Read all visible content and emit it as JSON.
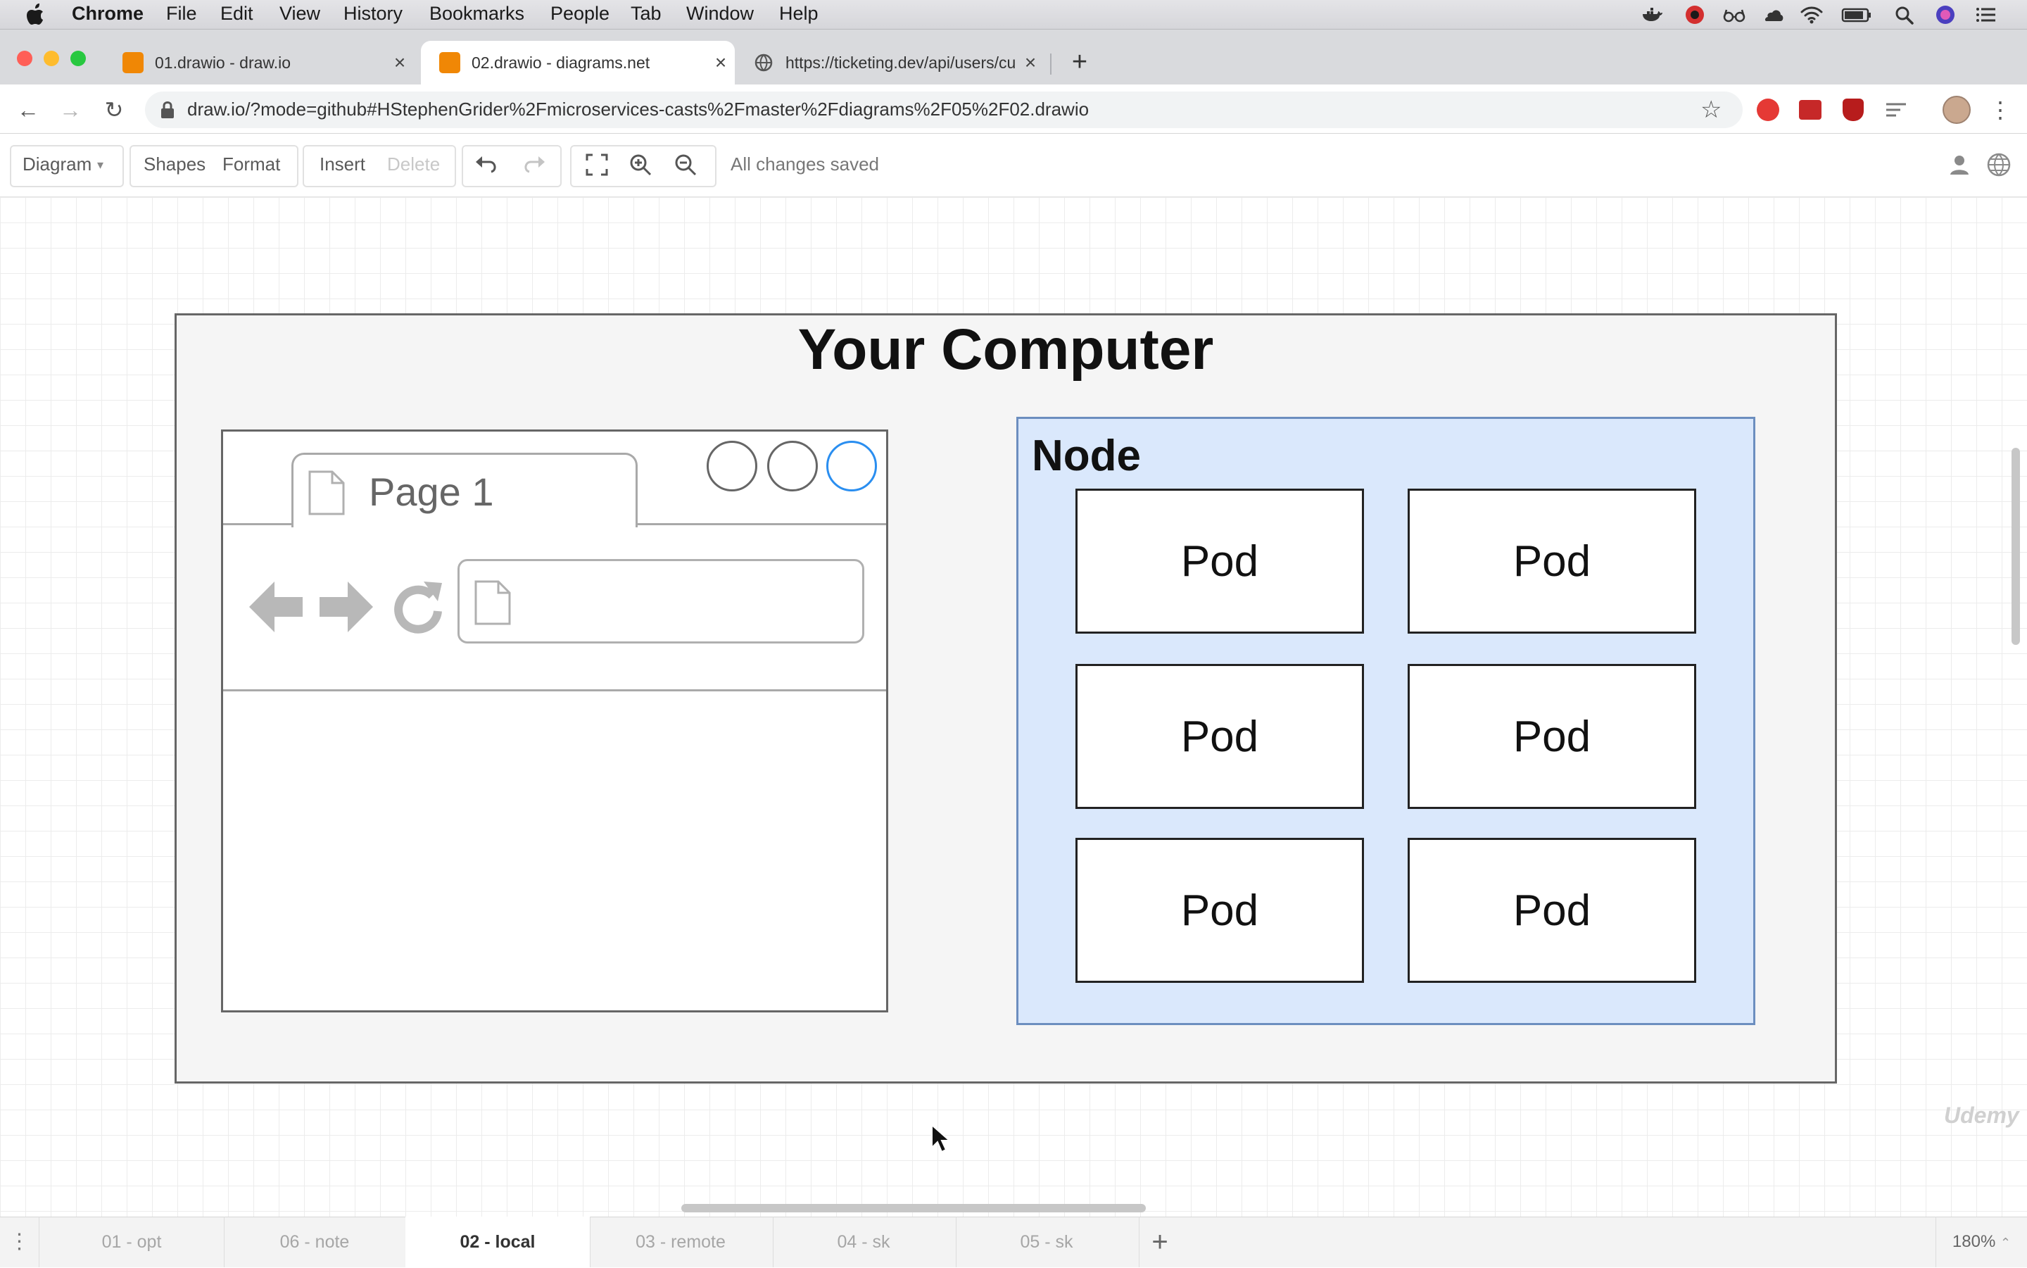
{
  "menubar": {
    "app": "Chrome",
    "items": [
      "File",
      "Edit",
      "View",
      "History",
      "Bookmarks",
      "People",
      "Tab",
      "Window",
      "Help"
    ]
  },
  "tabs": [
    {
      "title": "01.drawio - draw.io",
      "favicon": "drawio-icon",
      "active": false
    },
    {
      "title": "02.drawio - diagrams.net",
      "favicon": "drawio-icon",
      "active": true
    },
    {
      "title": "https://ticketing.dev/api/users/cu",
      "favicon": "globe-icon",
      "active": false
    }
  ],
  "address_bar": {
    "url": "draw.io/?mode=github#HStephenGrider%2Fmicroservices-casts%2Fmaster%2Fdiagrams%2F05%2F02.drawio"
  },
  "toolbar": {
    "diagram": "Diagram",
    "shapes": "Shapes",
    "format": "Format",
    "insert": "Insert",
    "delete": "Delete",
    "status": "All changes saved"
  },
  "diagram": {
    "title": "Your Computer",
    "browser_tab": "Page 1",
    "node_label": "Node",
    "pods": [
      "Pod",
      "Pod",
      "Pod",
      "Pod",
      "Pod",
      "Pod"
    ]
  },
  "watermark": "Udemy",
  "page_tabs": [
    {
      "label": "01 - opt",
      "active": false
    },
    {
      "label": "06 - note",
      "active": false
    },
    {
      "label": "02 - local",
      "active": true
    },
    {
      "label": "03 - remote",
      "active": false
    },
    {
      "label": "04 - sk",
      "active": false
    },
    {
      "label": "05 - sk",
      "active": false
    }
  ],
  "zoom": "180%",
  "colors": {
    "node_fill": "#dae8fc",
    "node_border": "#6c8ebf",
    "container_fill": "#f5f5f5",
    "accent_blue": "#2a8ef0"
  }
}
